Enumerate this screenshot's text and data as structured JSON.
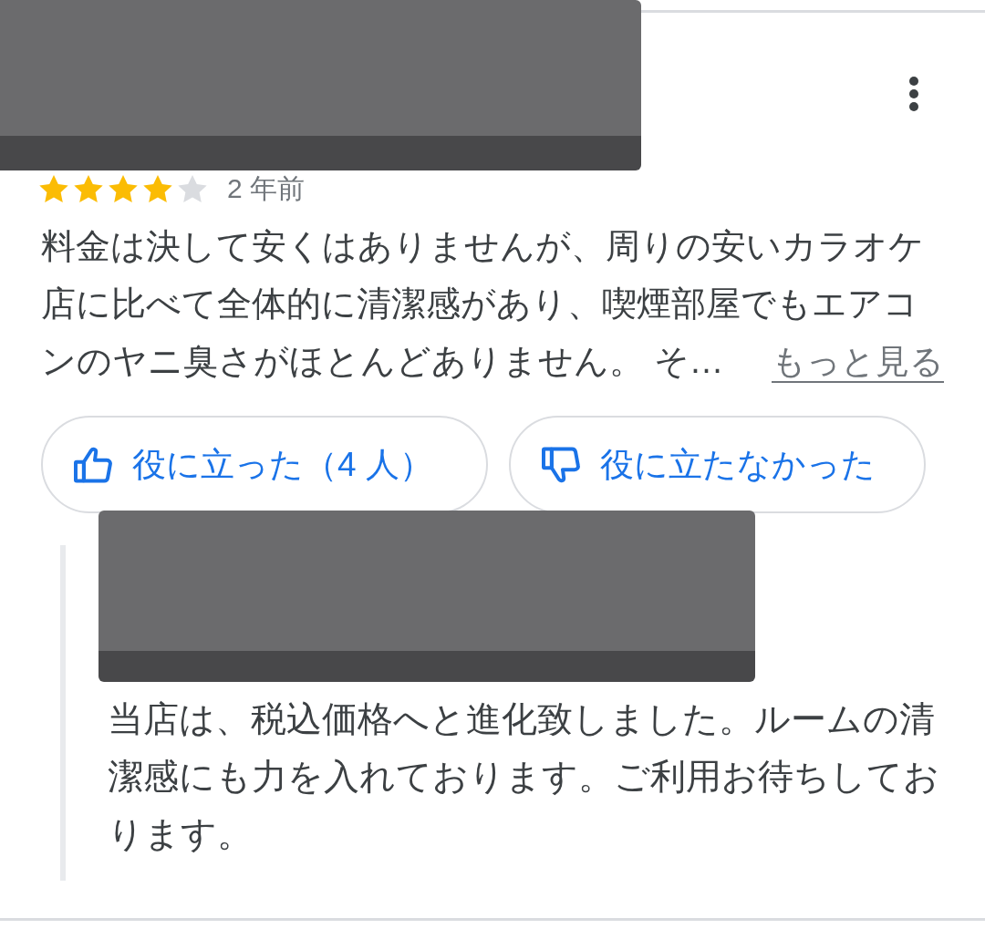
{
  "review": {
    "stars": 4,
    "time": "2 年前",
    "text": "料金は決して安くはありませんが、周りの安いカラオケ店に比べて全体的に清潔感があり、喫煙部屋でもエアコンのヤニ臭さがほとんどありません。 そ…",
    "more_link": "もっと見る"
  },
  "actions": [
    {
      "kind": "helpful",
      "label": "役に立った（4 人）"
    },
    {
      "kind": "not_helpful",
      "label": "役に立たなかった"
    }
  ],
  "owner_reply": {
    "text": "当店は、税込価格へと進化致しました。ルームの清潔感にも力を入れております。ご利用お待ちしております。"
  }
}
